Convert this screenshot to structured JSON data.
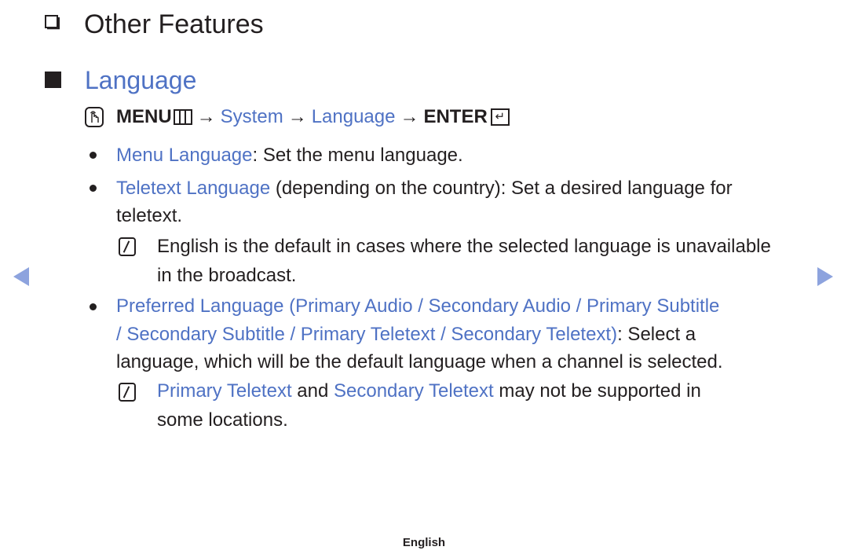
{
  "header": {
    "title": "Other Features",
    "title_icon": "hollow-square-bullet-icon"
  },
  "section": {
    "title": "Language",
    "icon": "filled-square-bullet-icon"
  },
  "path": {
    "om_icon": "remote-hand-icon",
    "menu_label": "MENU",
    "menu_icon": "menu-grid-icon",
    "arrow": "→",
    "system": "System",
    "language": "Language",
    "enter_label": "ENTER",
    "enter_icon": "enter-return-icon",
    "enter_glyph": "↵"
  },
  "items": [
    {
      "term": "Menu Language",
      "text": ": Set the menu language."
    },
    {
      "term": "Teletext Language",
      "text_line1": " (depending on the country): Set a desired language for",
      "text_line2": "teletext.",
      "note_line1": "English is the default in cases where the selected language is unavailable",
      "note_line2": "in the broadcast."
    },
    {
      "term_line1": "Preferred Language (Primary Audio / Secondary Audio / Primary Subtitle",
      "term_line2": "/ Secondary Subtitle / Primary Teletext / Secondary Teletext)",
      "text_line2": ": Select a",
      "text_line3": "language, which will be the default language when a channel is selected.",
      "note_term1": "Primary Teletext",
      "note_and": " and ",
      "note_term2": "Secondary Teletext",
      "note_text": " may not be supported in",
      "note_line2": "some locations."
    }
  ],
  "navigation": {
    "prev": "previous-page-arrow",
    "next": "next-page-arrow"
  },
  "footer": {
    "language": "English"
  },
  "colors": {
    "accent_blue": "#4f72c4",
    "nav_arrow": "#8da3de",
    "text": "#231f20"
  }
}
